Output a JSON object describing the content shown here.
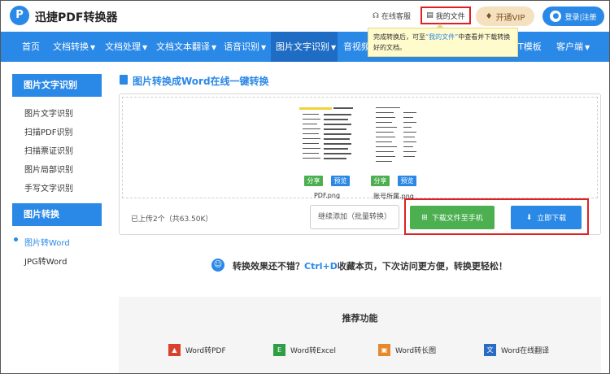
{
  "header": {
    "brand": "迅捷PDF转换器",
    "service": "在线客服",
    "my_files": "我的文件",
    "vip": "开通VIP",
    "login": "登录|注册"
  },
  "nav": [
    "首页",
    "文档转换",
    "文档处理",
    "文档文本翻译",
    "语音识别",
    "图片文字识别",
    "音视频",
    "T模板",
    "客户端"
  ],
  "tooltip": {
    "before": "完成转换后，可至",
    "link": "“我的文件”",
    "after": "中查看并下载转换好的文档。"
  },
  "sidebar": {
    "section1": "图片文字识别",
    "items1": [
      "图片文字识别",
      "扫描PDF识别",
      "扫描票证识别",
      "图片局部识别",
      "手写文字识别"
    ],
    "section2": "图片转换",
    "items2": [
      "图片转Word",
      "JPG转Word"
    ]
  },
  "main": {
    "title": "图片转换成Word在线一键转换",
    "files": [
      {
        "name": "PDF.png",
        "share": "分享",
        "preview": "预览"
      },
      {
        "name": "账号所属.png",
        "share": "分享",
        "preview": "预览"
      }
    ],
    "uploaded": "已上传2个（共63.50K）",
    "add_more": "继续添加（批量转换）",
    "download_phone": "下载文件至手机",
    "download_now": "立即下载",
    "promo_pre": "转换效果还不错？",
    "promo_hl": "Ctrl+D",
    "promo_post": "收藏本页，下次访问更方便，转换更轻松！"
  },
  "recommend": {
    "title": "推荐功能",
    "items": [
      "Word转PDF",
      "Word转Excel",
      "Word转长图",
      "Word在线翻译"
    ]
  },
  "colors": {
    "brand_blue": "#2a88e6",
    "green": "#4caf50",
    "highlight_red": "#e02020"
  }
}
